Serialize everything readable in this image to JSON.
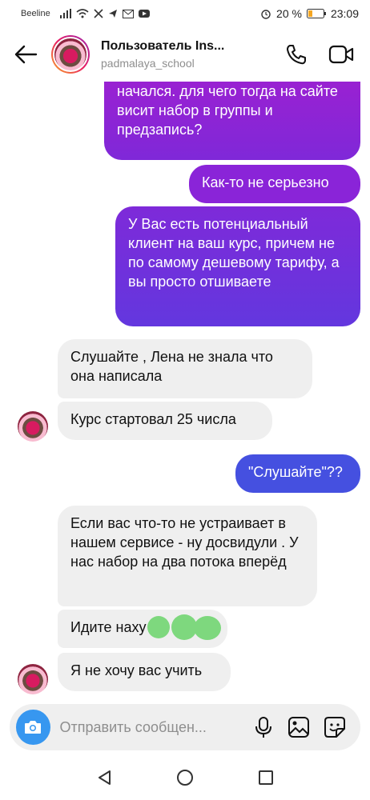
{
  "status_bar": {
    "carrier": "Beeline",
    "battery": "20 %",
    "time": "23:09"
  },
  "header": {
    "title": "Пользователь Ins...",
    "username": "padmalaya_school"
  },
  "messages": [
    {
      "direction": "out",
      "text": "сейчас вы пишите, что уже начался. для чего тогда на сайте висит набор в группы и предзапись?"
    },
    {
      "direction": "out",
      "text": "Как-то не серьезно"
    },
    {
      "direction": "out",
      "text": "У Вас есть потенциальный клиент на ваш курс, причем не по самому дешевому тарифу, а вы просто отшиваете"
    },
    {
      "direction": "in",
      "text": "Слушайте , Лена не знала что она написала"
    },
    {
      "direction": "in",
      "text": "Курс стартовал 25 числа"
    },
    {
      "direction": "out",
      "text": "\"Слушайте\"??"
    },
    {
      "direction": "in",
      "text": "Если вас что-то не устраивает в нашем сервисе - ну досвидули . У нас набор на два потока вперёд"
    },
    {
      "direction": "in",
      "text": "Идите наху"
    },
    {
      "direction": "in",
      "text": "Я не хочу вас учить"
    }
  ],
  "composer": {
    "placeholder": "Отправить сообщен..."
  },
  "colors": {
    "accent": "#3797f0",
    "bubble_purple": "#8e22d6",
    "bubble_blue": "#4550e0",
    "incoming": "#efefef"
  }
}
